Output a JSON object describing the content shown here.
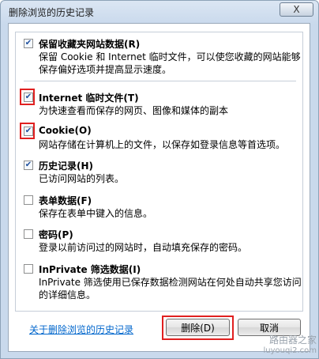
{
  "window": {
    "title": "删除浏览的历史记录",
    "close_label": "X"
  },
  "options": [
    {
      "title": "保留收藏夹网站数据(R)",
      "desc": "保留 Cookie 和 Internet 临时文件，可以使您收藏的网站能够保存偏好选项并提高显示速度。",
      "checked": true
    },
    {
      "title": "Internet 临时文件(T)",
      "desc": "为快速查看而保存的网页、图像和媒体的副本",
      "checked": true
    },
    {
      "title": "Cookie(O)",
      "desc": "网站存储在计算机上的文件，以保存如登录信息等首选项。",
      "checked": true
    },
    {
      "title": "历史记录(H)",
      "desc": "已访问网站的列表。",
      "checked": true
    },
    {
      "title": "表单数据(F)",
      "desc": "保存在表单中键入的信息。",
      "checked": false
    },
    {
      "title": "密码(P)",
      "desc": "登录以前访问过的网站时，自动填充保存的密码。",
      "checked": false
    },
    {
      "title": "InPrivate 筛选数据(I)",
      "desc": "InPrivate 筛选使用已保存数据检测网站在何处自动共享您访问的详细信息。",
      "checked": false
    }
  ],
  "check_glyph": "✔",
  "link": "关于删除浏览的历史记录",
  "buttons": {
    "delete": "删除(D)",
    "cancel": "取消"
  },
  "watermark": {
    "cn": "路由器之家",
    "en": "luyouqi2.com"
  },
  "colors": {
    "highlight": "#e02020",
    "link": "#0066cc"
  }
}
